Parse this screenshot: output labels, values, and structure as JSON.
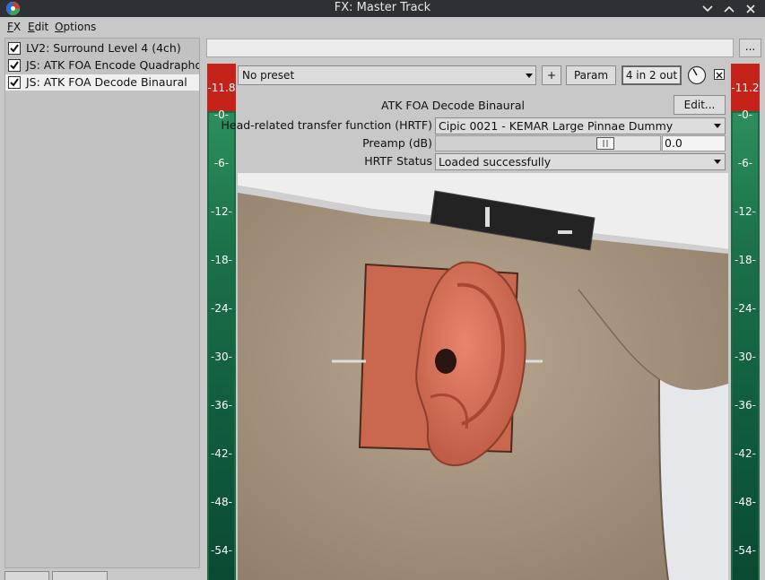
{
  "window": {
    "title": "FX: Master Track"
  },
  "menu": [
    "FX",
    "Edit",
    "Options"
  ],
  "fx_chain": [
    {
      "name": "LV2: Surround Level 4 (4ch)",
      "enabled": true,
      "selected": false
    },
    {
      "name": "JS: ATK FOA Encode Quadraphonic",
      "enabled": true,
      "selected": false
    },
    {
      "name": "JS: ATK FOA Decode Binaural",
      "enabled": true,
      "selected": true
    }
  ],
  "toolbar": {
    "preset": "No preset",
    "plus_label": "+",
    "param_label": "Param",
    "io_label": "4 in 2 out",
    "more_label": "..."
  },
  "meters": {
    "left_peak": "-11.8",
    "right_peak": "-11.2",
    "ticks": [
      "-0-",
      "-6-",
      "-12-",
      "-18-",
      "-24-",
      "-30-",
      "-36-",
      "-42-",
      "-48-",
      "-54-"
    ]
  },
  "plugin": {
    "title": "ATK FOA Decode Binaural",
    "edit_label": "Edit...",
    "hrtf_label": "Head-related transfer function (HRTF)",
    "hrtf_value": "Cipic 0021 - KEMAR Large Pinnae Dummy",
    "preamp_label": "Preamp (dB)",
    "preamp_value": "0.0",
    "preamp_slider_fraction": 0.78,
    "status_label": "HRTF Status",
    "status_value": "Loaded successfully"
  },
  "colors": {
    "titlebar": "#2d3034",
    "meter_peak": "#c5221a",
    "meter_bg": "#1b6b45"
  }
}
